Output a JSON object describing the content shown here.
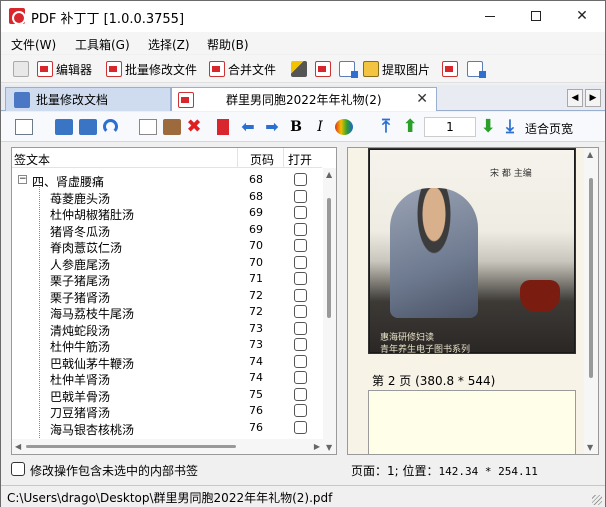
{
  "window": {
    "title": "PDF 补丁丁 [1.0.0.3755]",
    "minimize": "—",
    "maximize": "□",
    "close": "✕"
  },
  "menu": [
    {
      "label": "文件(W)"
    },
    {
      "label": "工具箱(G)"
    },
    {
      "label": "选择(Z)"
    },
    {
      "label": "帮助(B)"
    }
  ],
  "toolbar": {
    "editor": "编辑器",
    "batch_edit": "批量修改文件",
    "merge": "合并文件",
    "extract_images": "提取图片"
  },
  "tabs": {
    "batch": "批量修改文档",
    "document": "群里男同胞2022年年礼物(2)",
    "close": "✕",
    "nav_left": "◀",
    "nav_right": "▶"
  },
  "toolbar2": {
    "bold": "B",
    "italic": "I",
    "page_number": "1",
    "fit": "适合页宽"
  },
  "bookmarks": {
    "headers": {
      "title": "签文本",
      "page": "页码",
      "open": "打开"
    },
    "root": {
      "title": "四、肾虚腰痛",
      "page": "68"
    },
    "items": [
      {
        "title": "苺菱鹿头汤",
        "page": "68"
      },
      {
        "title": "杜仲胡椒猪肚汤",
        "page": "69"
      },
      {
        "title": "猪肾冬瓜汤",
        "page": "69"
      },
      {
        "title": "脊肉薏苡仁汤",
        "page": "70"
      },
      {
        "title": "人参鹿尾汤",
        "page": "70"
      },
      {
        "title": "栗子猪尾汤",
        "page": "71"
      },
      {
        "title": "栗子猪肾汤",
        "page": "72"
      },
      {
        "title": "海马荔枝牛尾汤",
        "page": "72"
      },
      {
        "title": "清炖蛇段汤",
        "page": "73"
      },
      {
        "title": "杜仲牛筋汤",
        "page": "73"
      },
      {
        "title": "巴戟仙茅牛鞭汤",
        "page": "74"
      },
      {
        "title": "杜仲羊肾汤",
        "page": "74"
      },
      {
        "title": "巴戟羊骨汤",
        "page": "75"
      },
      {
        "title": "刀豆猪肾汤",
        "page": "76"
      },
      {
        "title": "海马银杏核桃汤",
        "page": "76"
      }
    ]
  },
  "preview": {
    "author": "宋 都 主编",
    "caption1": "惠海研修妇读",
    "caption2": "青年养生电子图书系列",
    "page_label": "第 2 页 (380.8 * 544)"
  },
  "options": {
    "include_unselected": "修改操作包含未选中的内部书签"
  },
  "position": {
    "label": "页面：1; 位置：",
    "value": "142.34 * 254.11"
  },
  "status": {
    "path": "C:\\Users\\drago\\Desktop\\群里男同胞2022年年礼物(2).pdf"
  }
}
